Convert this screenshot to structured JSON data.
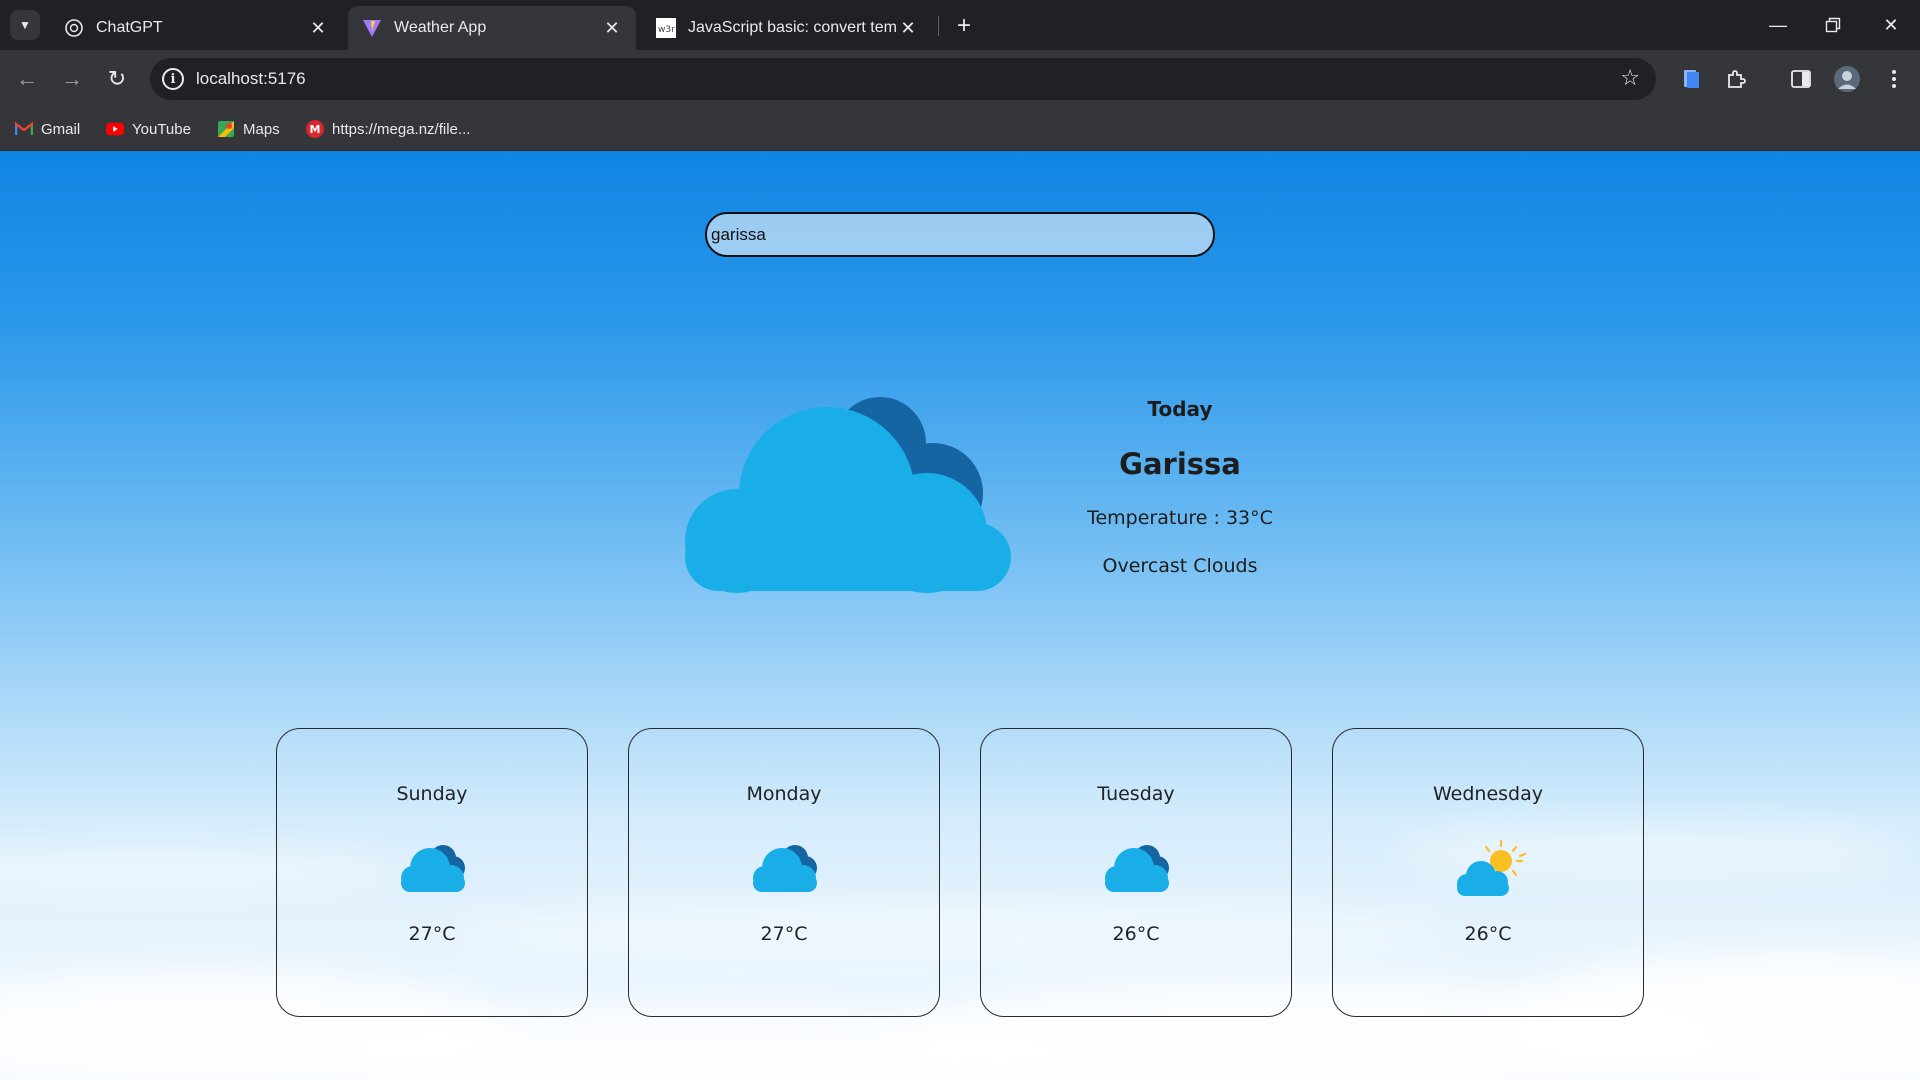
{
  "browser": {
    "tabs": [
      {
        "title": "ChatGPT",
        "icon": "chatgpt-icon"
      },
      {
        "title": "Weather App",
        "icon": "vite-icon"
      },
      {
        "title": "JavaScript basic: convert tempe",
        "icon": "w3resource-icon"
      }
    ],
    "w3_fav_text": "w3r",
    "url": "localhost:5176",
    "bookmarks": [
      {
        "label": "Gmail",
        "icon": "gmail-icon"
      },
      {
        "label": "YouTube",
        "icon": "youtube-icon"
      },
      {
        "label": "Maps",
        "icon": "maps-icon"
      },
      {
        "label": "https://mega.nz/file...",
        "icon": "mega-icon"
      }
    ],
    "mega_fav_text": "M"
  },
  "app": {
    "search": {
      "value": "garissa",
      "placeholder": ""
    },
    "current": {
      "heading": "Today",
      "city": "Garissa",
      "temperature": "Temperature : 33°C",
      "description": "Overcast Clouds",
      "icon": "overcast-clouds-icon"
    },
    "forecast": [
      {
        "day": "Sunday",
        "temp": "27°C",
        "icon": "cloud-icon"
      },
      {
        "day": "Monday",
        "temp": "27°C",
        "icon": "cloud-icon"
      },
      {
        "day": "Tuesday",
        "temp": "26°C",
        "icon": "cloud-icon"
      },
      {
        "day": "Wednesday",
        "temp": "26°C",
        "icon": "partly-sunny-icon"
      }
    ]
  },
  "colors": {
    "cloud_light": "#1aaee9",
    "cloud_dark": "#1565a3",
    "sun": "#fbbf24"
  }
}
